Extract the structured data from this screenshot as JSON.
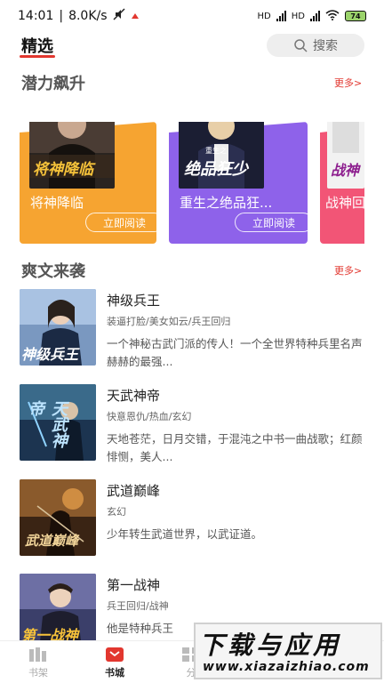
{
  "status": {
    "time": "14:01",
    "speed": "8.0K/s",
    "battery": "74",
    "network1": "HD",
    "network2": "HD"
  },
  "header": {
    "selected_tab": "精选",
    "search_label": "搜索"
  },
  "potential": {
    "title": "潜力飙升",
    "more": "更多>",
    "cards": [
      {
        "name": "将神降临",
        "cover_text": "将神降临",
        "button": "立即阅读",
        "color": "#f6a431"
      },
      {
        "name": "重生之绝品狂...",
        "cover_text": "绝品狂少",
        "cover_sub": "重生之",
        "button": "立即阅读",
        "color": "#8e62ea"
      },
      {
        "name": "战神回",
        "cover_text": "战神",
        "color": "#f25576"
      }
    ]
  },
  "hot": {
    "title": "爽文来袭",
    "more": "更多>",
    "books": [
      {
        "title": "神级兵王",
        "tags": "装逼打脸/美女如云/兵王回归",
        "desc": "一个神秘古武门派的传人！一个全世界特种兵里名声赫赫的最强...",
        "cover_text": "神级兵王"
      },
      {
        "title": "天武神帝",
        "tags": "快意恩仇/热血/玄幻",
        "desc": "天地苍茫，日月交错，于混沌之中书一曲战歌；红颜悱恻，美人...",
        "cover_text": "天武神帝"
      },
      {
        "title": "武道巅峰",
        "tags": "玄幻",
        "desc": "少年转生武道世界，以武证道。",
        "cover_text": "武道巅峰"
      },
      {
        "title": "第一战神",
        "tags": "兵王回归/战神",
        "desc": "他是特种兵王",
        "cover_text": "第一战神"
      }
    ]
  },
  "tabbar": {
    "items": [
      {
        "label": "书架"
      },
      {
        "label": "书城"
      },
      {
        "label": "分"
      }
    ]
  },
  "watermark": {
    "line1": "下载与应用",
    "line2": "www.xiazaizhiao.com"
  }
}
